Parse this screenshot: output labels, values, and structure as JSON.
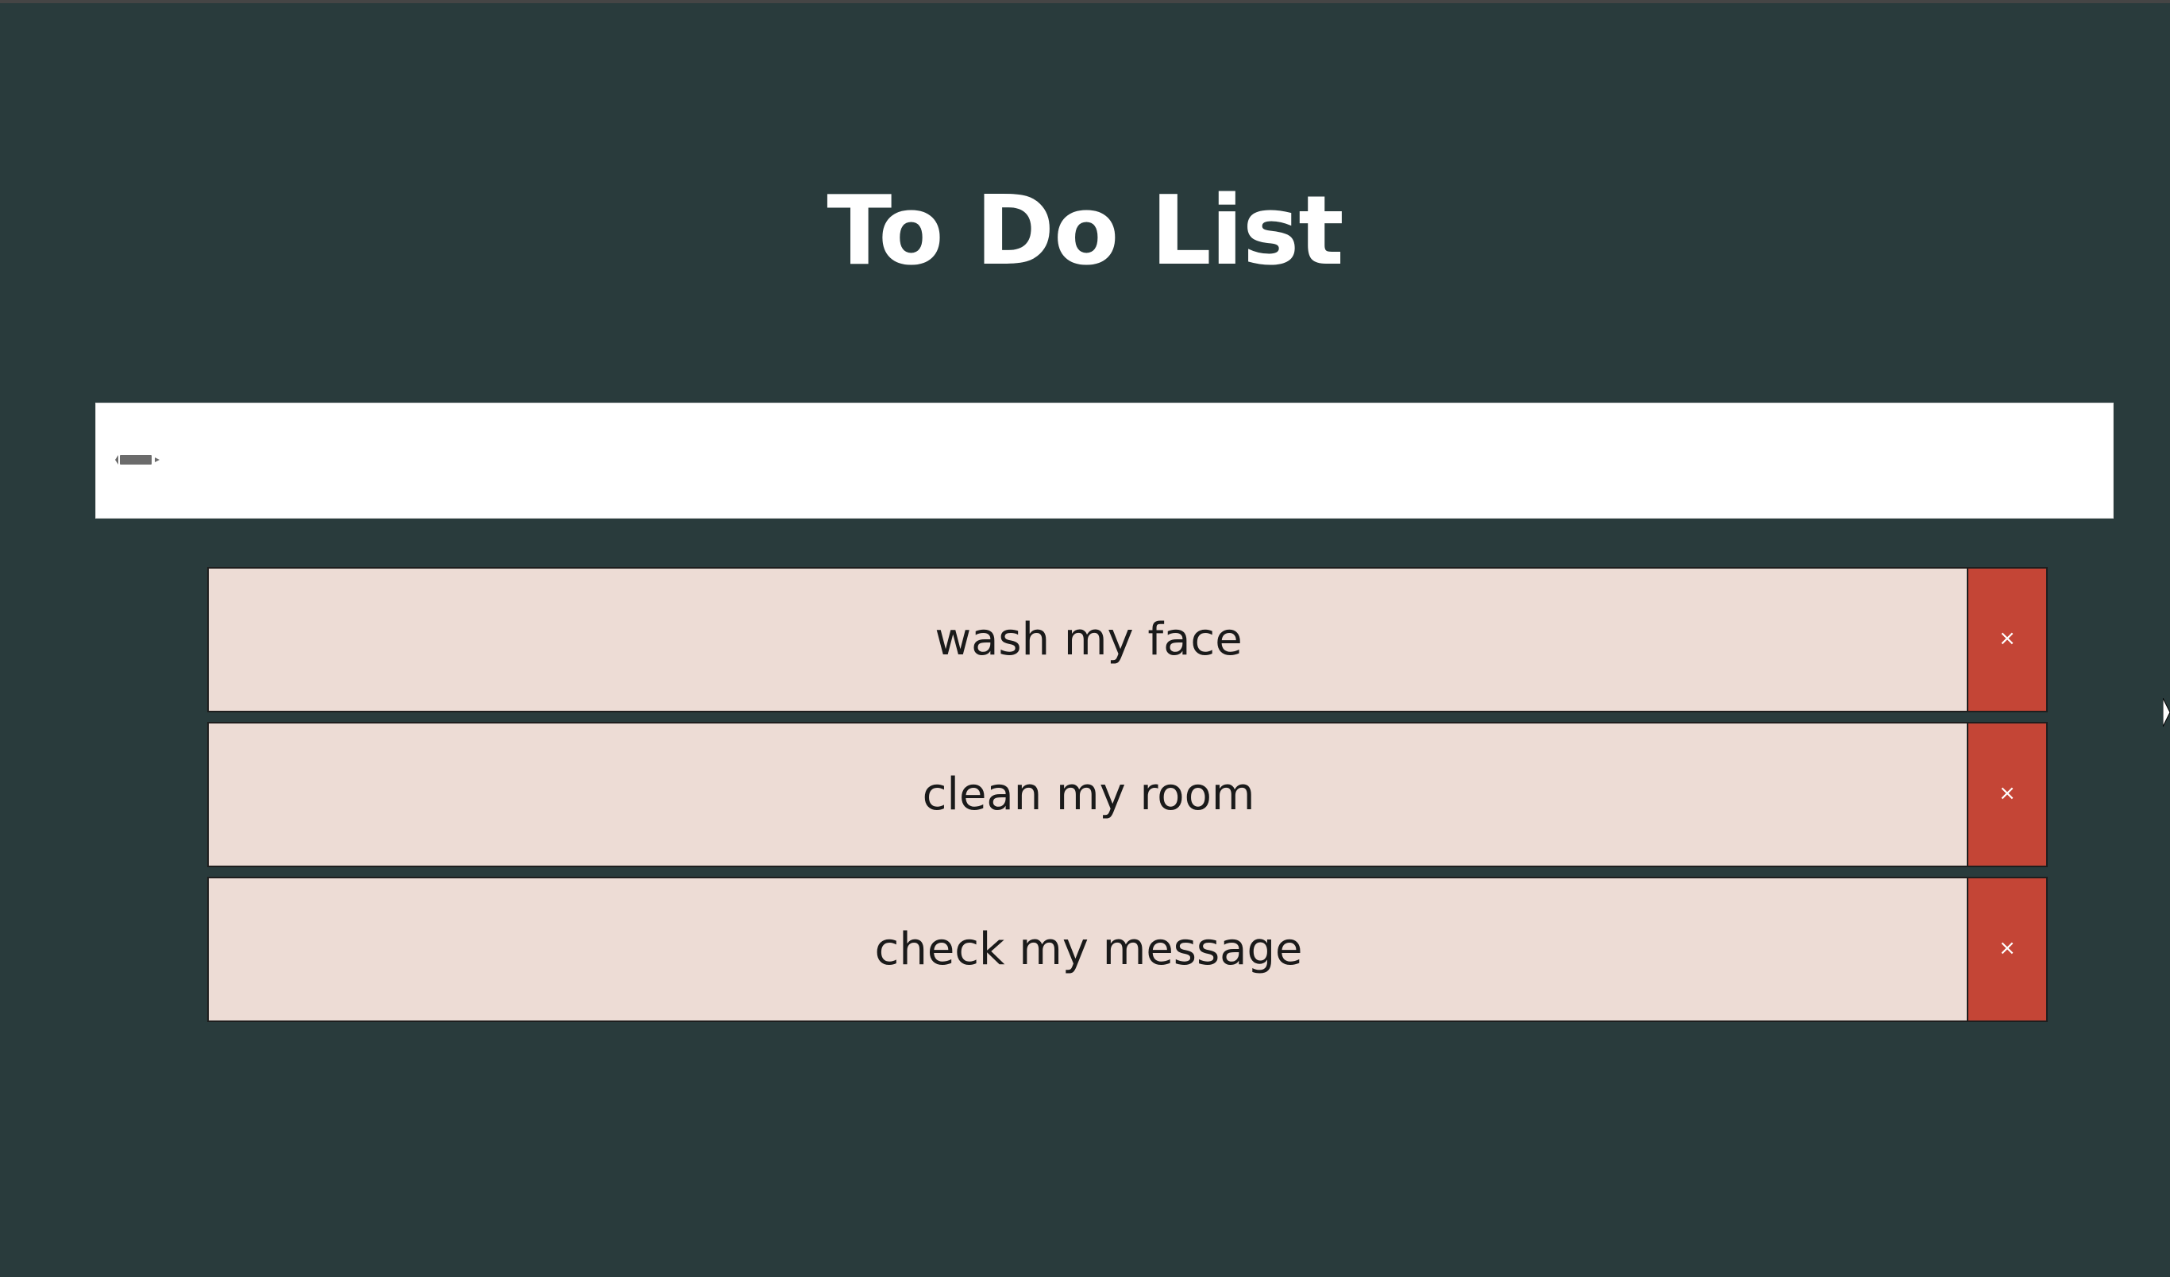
{
  "header": {
    "title": "To Do List"
  },
  "new_task": {
    "value": "",
    "placeholder": "",
    "icon": "pen-icon"
  },
  "todos": [
    {
      "text": "wash my face",
      "delete_label": "×"
    },
    {
      "text": "clean my room",
      "delete_label": "×"
    },
    {
      "text": "check my message",
      "delete_label": "×"
    }
  ],
  "colors": {
    "background": "#293b3c",
    "item_background": "#eddcd5",
    "delete_button": "#c44536",
    "title_text": "#ffffff"
  }
}
